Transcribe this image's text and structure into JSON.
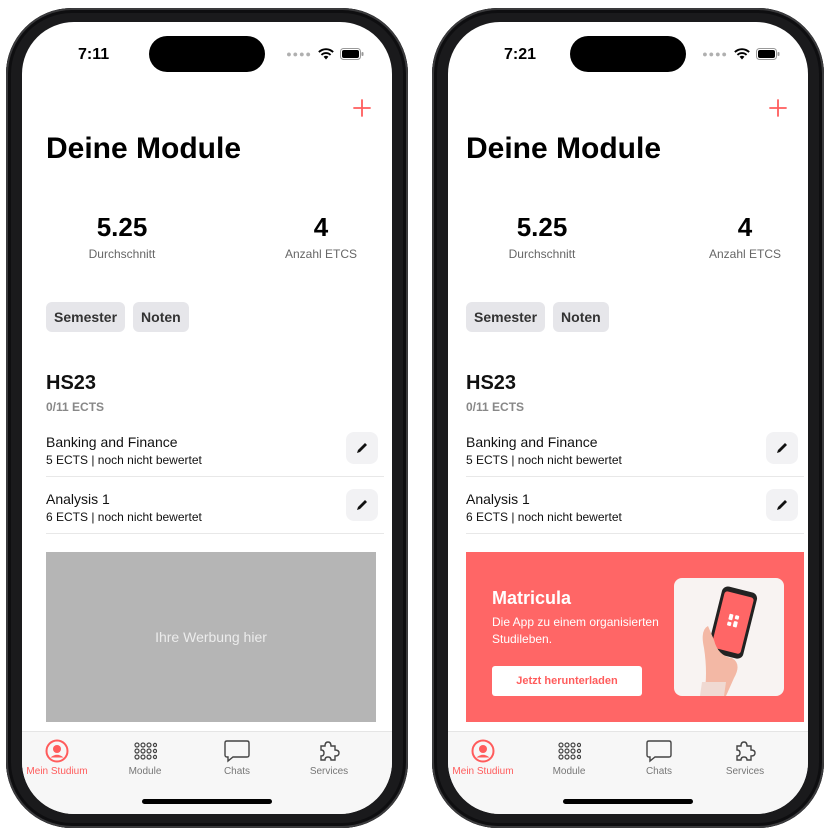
{
  "screens": [
    {
      "status": {
        "time": "7:11"
      },
      "title": "Deine Module",
      "stats": {
        "average": "5.25",
        "average_label": "Durchschnitt",
        "ects": "4",
        "ects_label": "Anzahl ETCS"
      },
      "chips": [
        "Semester",
        "Noten"
      ],
      "semester": {
        "name": "HS23",
        "ects": "0/11 ECTS"
      },
      "modules": [
        {
          "name": "Banking and Finance",
          "meta": "5 ECTS | noch nicht bewertet"
        },
        {
          "name": "Analysis 1",
          "meta": "6 ECTS | noch nicht bewertet"
        }
      ],
      "ad": {
        "type": "placeholder",
        "text": "Ihre Werbung hier"
      },
      "tabs": [
        "Mein Studium",
        "Module",
        "Chats",
        "Services"
      ]
    },
    {
      "status": {
        "time": "7:21"
      },
      "title": "Deine Module",
      "stats": {
        "average": "5.25",
        "average_label": "Durchschnitt",
        "ects": "4",
        "ects_label": "Anzahl ETCS"
      },
      "chips": [
        "Semester",
        "Noten"
      ],
      "semester": {
        "name": "HS23",
        "ects": "0/11 ECTS"
      },
      "modules": [
        {
          "name": "Banking and Finance",
          "meta": "5 ECTS | noch nicht bewertet"
        },
        {
          "name": "Analysis 1",
          "meta": "6 ECTS | noch nicht bewertet"
        }
      ],
      "ad": {
        "type": "banner",
        "title": "Matricula",
        "subtitle": "Die App zu einem organisierten Studileben.",
        "button": "Jetzt herunterladen"
      },
      "tabs": [
        "Mein Studium",
        "Module",
        "Chats",
        "Services"
      ]
    }
  ],
  "colors": {
    "accent": "#ff5c5c",
    "ad_red": "#ff6666",
    "ad_gray": "#b5b5b5",
    "chip_bg": "#e6e6ea"
  },
  "icons": {
    "add": "plus-icon",
    "edit": "pencil-icon",
    "tab_icons": [
      "person-circle-icon",
      "grid-dots-icon",
      "chat-bubble-icon",
      "puzzle-icon"
    ]
  }
}
